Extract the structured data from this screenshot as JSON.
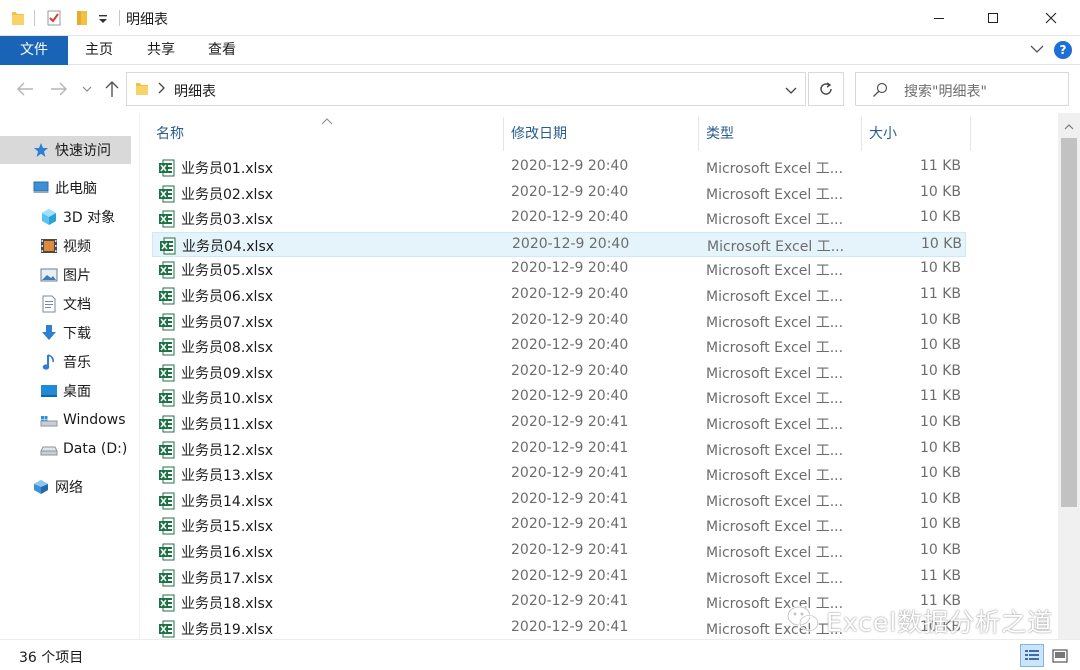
{
  "window": {
    "title": "明细表",
    "controls": [
      "minimize",
      "maximize",
      "close"
    ]
  },
  "quick_access_toolbar": {
    "icons": [
      "folder-icon",
      "properties-check-icon",
      "new-folder-icon",
      "customize-dropdown-icon"
    ]
  },
  "ribbon": {
    "tabs": [
      {
        "label": "文件",
        "active": true
      },
      {
        "label": "主页"
      },
      {
        "label": "共享"
      },
      {
        "label": "查看"
      }
    ],
    "help_label": "?"
  },
  "nav": {
    "address_path": "明细表",
    "search_placeholder": "搜索\"明细表\""
  },
  "sidebar": {
    "items": [
      {
        "label": "快速访问",
        "icon": "star-icon",
        "selected": true
      },
      {
        "label": "此电脑",
        "icon": "computer-icon"
      },
      {
        "label": "3D 对象",
        "icon": "3d-objects-icon"
      },
      {
        "label": "视频",
        "icon": "video-icon"
      },
      {
        "label": "图片",
        "icon": "pictures-icon"
      },
      {
        "label": "文档",
        "icon": "documents-icon"
      },
      {
        "label": "下载",
        "icon": "download-icon"
      },
      {
        "label": "音乐",
        "icon": "music-icon"
      },
      {
        "label": "桌面",
        "icon": "desktop-icon"
      },
      {
        "label": "Windows",
        "icon": "windows-drive-icon"
      },
      {
        "label": "Data (D:)",
        "icon": "drive-icon"
      },
      {
        "label": "网络",
        "icon": "network-icon"
      }
    ]
  },
  "columns": {
    "name": "名称",
    "modified": "修改日期",
    "type": "类型",
    "size": "大小"
  },
  "files": [
    {
      "name": "业务员01.xlsx",
      "modified": "2020-12-9 20:40",
      "type": "Microsoft Excel 工...",
      "size": "11 KB"
    },
    {
      "name": "业务员02.xlsx",
      "modified": "2020-12-9 20:40",
      "type": "Microsoft Excel 工...",
      "size": "10 KB"
    },
    {
      "name": "业务员03.xlsx",
      "modified": "2020-12-9 20:40",
      "type": "Microsoft Excel 工...",
      "size": "10 KB"
    },
    {
      "name": "业务员04.xlsx",
      "modified": "2020-12-9 20:40",
      "type": "Microsoft Excel 工...",
      "size": "10 KB",
      "hover": true
    },
    {
      "name": "业务员05.xlsx",
      "modified": "2020-12-9 20:40",
      "type": "Microsoft Excel 工...",
      "size": "10 KB"
    },
    {
      "name": "业务员06.xlsx",
      "modified": "2020-12-9 20:40",
      "type": "Microsoft Excel 工...",
      "size": "11 KB"
    },
    {
      "name": "业务员07.xlsx",
      "modified": "2020-12-9 20:40",
      "type": "Microsoft Excel 工...",
      "size": "10 KB"
    },
    {
      "name": "业务员08.xlsx",
      "modified": "2020-12-9 20:40",
      "type": "Microsoft Excel 工...",
      "size": "10 KB"
    },
    {
      "name": "业务员09.xlsx",
      "modified": "2020-12-9 20:40",
      "type": "Microsoft Excel 工...",
      "size": "10 KB"
    },
    {
      "name": "业务员10.xlsx",
      "modified": "2020-12-9 20:40",
      "type": "Microsoft Excel 工...",
      "size": "11 KB"
    },
    {
      "name": "业务员11.xlsx",
      "modified": "2020-12-9 20:41",
      "type": "Microsoft Excel 工...",
      "size": "10 KB"
    },
    {
      "name": "业务员12.xlsx",
      "modified": "2020-12-9 20:41",
      "type": "Microsoft Excel 工...",
      "size": "10 KB"
    },
    {
      "name": "业务员13.xlsx",
      "modified": "2020-12-9 20:41",
      "type": "Microsoft Excel 工...",
      "size": "10 KB"
    },
    {
      "name": "业务员14.xlsx",
      "modified": "2020-12-9 20:41",
      "type": "Microsoft Excel 工...",
      "size": "10 KB"
    },
    {
      "name": "业务员15.xlsx",
      "modified": "2020-12-9 20:41",
      "type": "Microsoft Excel 工...",
      "size": "10 KB"
    },
    {
      "name": "业务员16.xlsx",
      "modified": "2020-12-9 20:41",
      "type": "Microsoft Excel 工...",
      "size": "10 KB"
    },
    {
      "name": "业务员17.xlsx",
      "modified": "2020-12-9 20:41",
      "type": "Microsoft Excel 工...",
      "size": "11 KB"
    },
    {
      "name": "业务员18.xlsx",
      "modified": "2020-12-9 20:41",
      "type": "Microsoft Excel 工...",
      "size": "11 KB"
    },
    {
      "name": "业务员19.xlsx",
      "modified": "2020-12-9 20:41",
      "type": "Microsoft Excel 工...",
      "size": "10 KB"
    }
  ],
  "status": {
    "item_count": "36 个项目",
    "views": [
      "details-view-icon",
      "large-icons-view-icon"
    ],
    "active_view": "details-view-icon"
  },
  "watermark": {
    "text": "Excel数据分析之道"
  },
  "colors": {
    "file_tab": "#1a64b8",
    "column_header": "#2a5d8f",
    "hover_row": "#e5f3fb",
    "sidebar_selected": "#d9d9d9",
    "excel_green": "#1e7145"
  }
}
